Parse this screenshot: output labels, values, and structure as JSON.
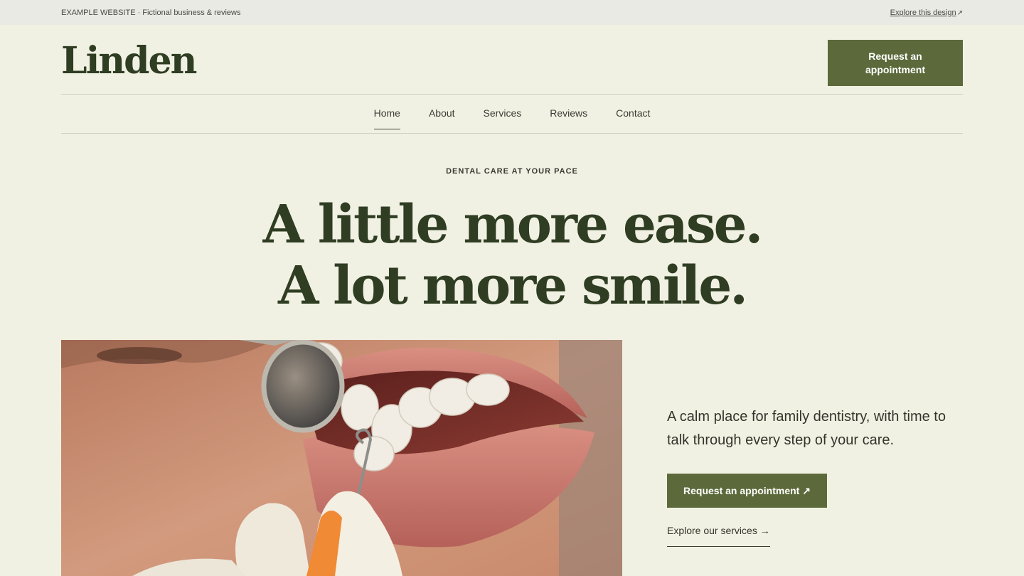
{
  "topbar": {
    "site_note": "EXAMPLE WEBSITE · Fictional business & reviews",
    "explore_link": "Explore this design",
    "explore_icon": "arrow-up-right-icon"
  },
  "header": {
    "logo": "Linden",
    "cta_label": "Request an appointment"
  },
  "nav": {
    "items": [
      {
        "label": "Home",
        "active": true
      },
      {
        "label": "About",
        "active": false
      },
      {
        "label": "Services",
        "active": false
      },
      {
        "label": "Reviews",
        "active": false
      },
      {
        "label": "Contact",
        "active": false
      }
    ]
  },
  "hero": {
    "eyebrow": "DENTAL CARE AT YOUR PACE",
    "headline_line1": "A little more ease.",
    "headline_line2": "A lot more smile.",
    "description": "A calm place for family dentistry, with time to talk through every step of your care.",
    "cta_label": "Request an appointment",
    "cta_icon": "arrow-up-right-icon",
    "services_link": "Explore our services",
    "services_icon": "arrow-right-icon"
  },
  "colors": {
    "background": "#f1f1e3",
    "brand_green": "#5c6a3b",
    "heading_green": "#2f3d23",
    "topbar_bg": "#eaeae4"
  }
}
